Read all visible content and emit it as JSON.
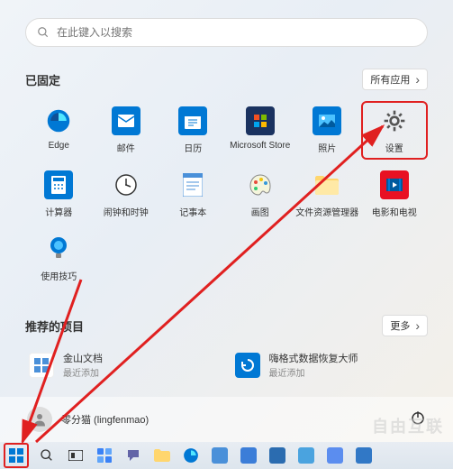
{
  "search": {
    "placeholder": "在此键入以搜索"
  },
  "pinned": {
    "title": "已固定",
    "all_apps_label": "所有应用",
    "apps": [
      {
        "label": "Edge"
      },
      {
        "label": "邮件"
      },
      {
        "label": "日历"
      },
      {
        "label": "Microsoft Store"
      },
      {
        "label": "照片"
      },
      {
        "label": "设置"
      },
      {
        "label": "计算器"
      },
      {
        "label": "闹钟和时钟"
      },
      {
        "label": "记事本"
      },
      {
        "label": "画图"
      },
      {
        "label": "文件资源管理器"
      },
      {
        "label": "电影和电视"
      },
      {
        "label": "使用技巧"
      }
    ]
  },
  "recommended": {
    "title": "推荐的项目",
    "more_label": "更多",
    "items": [
      {
        "title": "金山文档",
        "subtitle": "最近添加"
      },
      {
        "title": "嗨格式数据恢复大师",
        "subtitle": "最近添加"
      }
    ]
  },
  "user": {
    "name": "零分猫 (lingfenmao)"
  },
  "watermark": "自由互联",
  "annotation": {
    "highlighted_app_index": 5,
    "start_highlighted": true
  }
}
